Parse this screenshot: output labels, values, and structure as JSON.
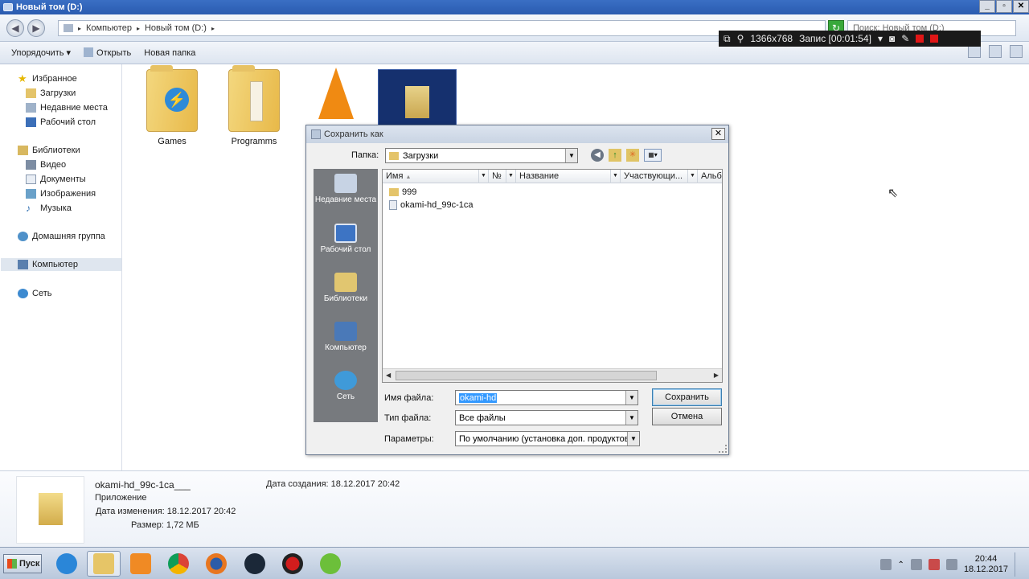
{
  "window": {
    "title": "Новый том (D:)"
  },
  "address": {
    "crumbs": [
      "Компьютер",
      "Новый том (D:)"
    ],
    "search_placeholder": "Поиск: Новый том (D:)"
  },
  "recorder": {
    "resolution": "1366x768",
    "status": "Запис [00:01:54]"
  },
  "toolbar": {
    "organize": "Упорядочить",
    "open": "Открыть",
    "new_folder": "Новая папка"
  },
  "nav": {
    "favorites": "Избранное",
    "downloads": "Загрузки",
    "recent": "Недавние места",
    "desktop": "Рабочий стол",
    "libraries": "Библиотеки",
    "video": "Видео",
    "documents": "Документы",
    "images": "Изображения",
    "music": "Музыка",
    "homegroup": "Домашняя группа",
    "computer": "Компьютер",
    "network": "Сеть"
  },
  "content": {
    "items": [
      {
        "label": "Games"
      },
      {
        "label": "Programms"
      }
    ]
  },
  "dialog": {
    "title": "Сохранить как",
    "folder_label": "Папка:",
    "folder_value": "Загрузки",
    "places": [
      "Недавние места",
      "Рабочий стол",
      "Библиотеки",
      "Компьютер",
      "Сеть"
    ],
    "columns": [
      "Имя",
      "№",
      "Название",
      "Участвующи...",
      "Альб"
    ],
    "files": [
      "999",
      "okami-hd_99c-1ca"
    ],
    "filename_label": "Имя файла:",
    "filename_value": "okami-hd",
    "filetype_label": "Тип файла:",
    "filetype_value": "Все файлы",
    "params_label": "Параметры:",
    "params_value": "По умолчанию (установка доп. продуктов)",
    "save_button": "Сохранить",
    "cancel_button": "Отмена"
  },
  "details": {
    "name": "okami-hd_99c-1ca___",
    "type": "Приложение",
    "modified": "Дата изменения: 18.12.2017 20:42",
    "size": "Размер: 1,72 МБ",
    "created": "Дата создания: 18.12.2017 20:42"
  },
  "taskbar": {
    "start": "Пуск",
    "time": "20:44",
    "date": "18.12.2017"
  },
  "colors": {
    "accent": "#3399ff",
    "titlebar": "#2a5bb0",
    "rec": "#e01616"
  }
}
